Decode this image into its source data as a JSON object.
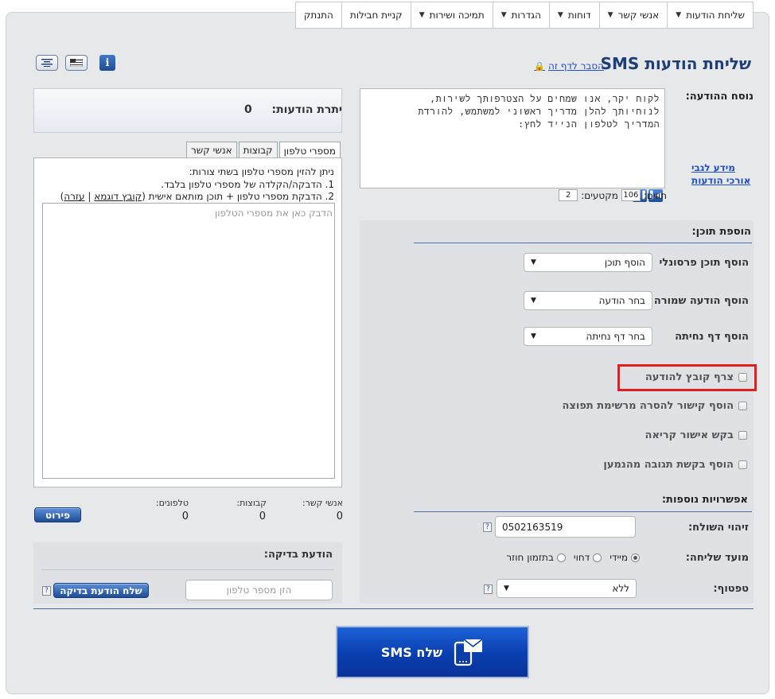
{
  "nav": [
    {
      "label": "שליחת הודעות",
      "dropdown": true
    },
    {
      "label": "אנשי קשר",
      "dropdown": true
    },
    {
      "label": "דוחות",
      "dropdown": true
    },
    {
      "label": "הגדרות",
      "dropdown": true
    },
    {
      "label": "תמיכה ושירות",
      "dropdown": true
    },
    {
      "label": "קניית חבילות",
      "dropdown": false
    },
    {
      "label": "התנתק",
      "dropdown": false
    }
  ],
  "header": {
    "title": "שליחת הודעות SMS",
    "help_link": "הסבר לדף זה"
  },
  "message": {
    "label": "נוסח ההודעה:",
    "text": "לקוח יקר, אנו שמחים על הצטרפותך לשירות,\nלנוחיותך להלן מדריך ראשוני למשתמש, להורדת\nהמדריך לטלפון הנייד לחץ:",
    "info_link": "מידע לגבי אורכי הודעות",
    "chars_label": "תווים:",
    "chars_value": "106",
    "segments_label": "מקטעים:",
    "segments_value": "2"
  },
  "add_content": {
    "title": "הוספת תוכן:",
    "personal_label": "הוסף תוכן פרסונלי",
    "personal_value": "הוסף תוכן",
    "saved_label": "הוסף הודעה שמורה",
    "saved_value": "בחר הודעה",
    "landing_label": "הוסף דף נחיתה",
    "landing_value": "בחר דף נחיתה",
    "checks": [
      "צרף קובץ להודעה",
      "הוסף קישור להסרה מרשימת תפוצה",
      "בקש אישור קריאה",
      "הוסף בקשת תגובה מהנמען"
    ]
  },
  "options": {
    "title": "אפשרויות נוספות:",
    "sender_label": "זיהוי השולח:",
    "sender_value": "0502163519",
    "timing_label": "מועד שליחה:",
    "timing_options": [
      "מיידי",
      "דחוי",
      "בתזמון חוזר"
    ],
    "throttle_label": "טפטוף:",
    "throttle_value": "ללא"
  },
  "quota": {
    "label": "יתרת הודעות:",
    "value": "0"
  },
  "tabs": [
    "מספרי טלפון",
    "קבוצות",
    "אנשי קשר"
  ],
  "phones": {
    "intro": "ניתן להזין מספרי טלפון בשתי צורות:",
    "line1": "1. הדבקה/הקלדה של מספרי טלפון בלבד.",
    "line2": "2. הדבקת מספרי טלפון + תוכן מותאם אישית (",
    "sample_link": "קובץ דוגמא",
    "sep": " | ",
    "help_link": "עזרה",
    "close": ")",
    "placeholder": "הדבק כאן את מספרי הטלפון"
  },
  "stats": {
    "contacts_label": "אנשי קשר:",
    "contacts_value": "0",
    "groups_label": "קבוצות:",
    "groups_value": "0",
    "phones_label": "טלפונים:",
    "phones_value": "0",
    "details_button": "פירוט"
  },
  "test": {
    "title": "הודעת בדיקה:",
    "placeholder": "הזן מספר טלפון",
    "button": "שלח הודעת בדיקה"
  },
  "send_button": "שלח SMS",
  "colors": {
    "title": "#1c3f78",
    "link": "#1e50c8",
    "highlight": "#e02020",
    "send": "#0a3eae"
  }
}
